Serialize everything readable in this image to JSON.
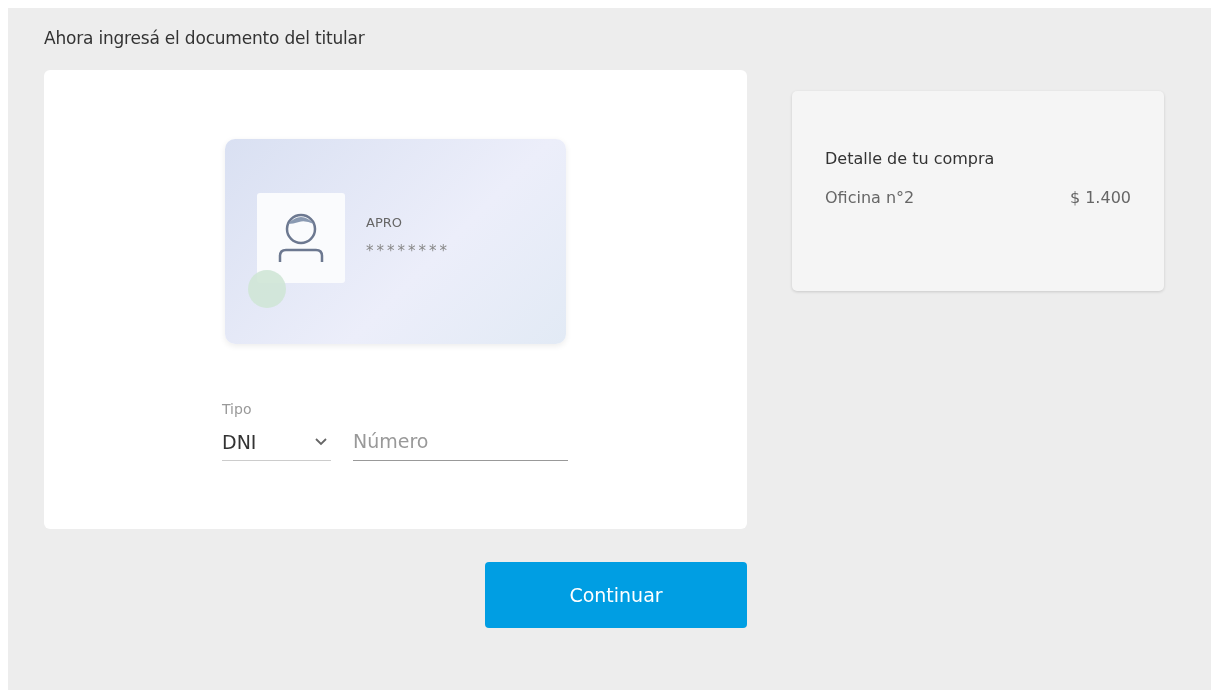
{
  "heading": "Ahora ingresá el documento del titular",
  "document_card": {
    "name": "APRO",
    "number": "********"
  },
  "form": {
    "type_label": "Tipo",
    "type_value": "DNI",
    "number_placeholder": "Número"
  },
  "summary": {
    "title": "Detalle de tu compra",
    "items": [
      {
        "label": "Oficina n°2",
        "amount": "$ 1.400"
      }
    ]
  },
  "button": "Continuar"
}
